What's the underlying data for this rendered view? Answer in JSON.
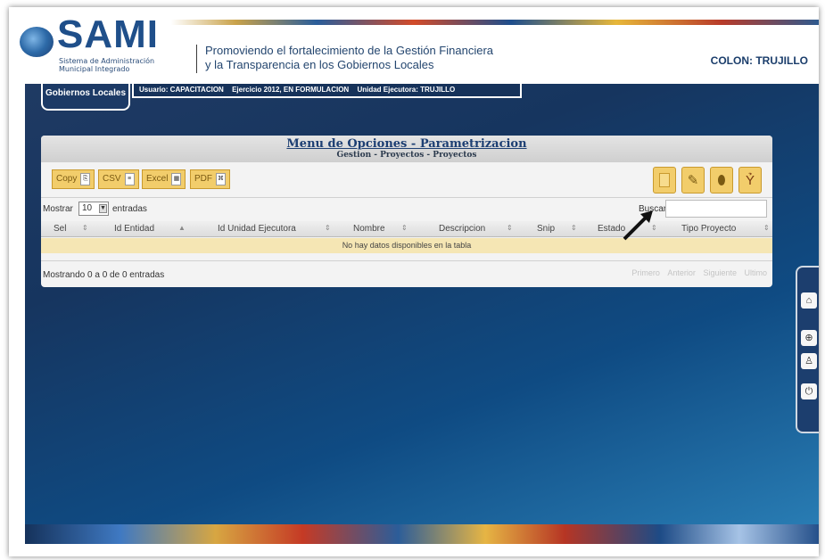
{
  "header": {
    "logo_title": "SAMI",
    "logo_subtitle_line1": "Sistema de Administración",
    "logo_subtitle_line2": "Municipal Integrado",
    "tagline_line1": "Promoviendo el fortalecimiento de la Gestión Financiera",
    "tagline_line2": "y la Transparencia en los Gobiernos Locales",
    "municipio": "COLON: TRUJILLO"
  },
  "nav": {
    "tab_label": "Gobiernos Locales",
    "user": "Usuario: CAPACITACION",
    "exercise": "Ejercicio 2012, EN FORMULACION",
    "unit": "Unidad Ejecutora: TRUJILLO"
  },
  "panel": {
    "title": "Menu de Opciones - Parametrizacion",
    "subtitle": "Gestion - Proyectos - Proyectos"
  },
  "export_buttons": [
    "Copy",
    "CSV",
    "Excel",
    "PDF"
  ],
  "action_buttons": [
    {
      "icon": "new-document-icon"
    },
    {
      "icon": "edit-pencil-icon"
    },
    {
      "icon": "eraser-icon"
    },
    {
      "icon": "broom-icon"
    }
  ],
  "table_controls": {
    "show_label": "Mostrar",
    "page_length": "10",
    "entries_label": "entradas",
    "search_label": "Buscar:",
    "search_value": ""
  },
  "table": {
    "columns": [
      "Sel",
      "Id Entidad",
      "Id Unidad Ejecutora",
      "Nombre",
      "Descripcion",
      "Snip",
      "Estado",
      "Tipo Proyecto"
    ],
    "empty_message": "No hay datos disponibles en la tabla"
  },
  "footer": {
    "info": "Mostrando 0 a 0 de 0 entradas",
    "pager": [
      "Primero",
      "Anterior",
      "Siguiente",
      "Ultimo"
    ]
  },
  "side_widget": {
    "buttons": [
      "home-icon",
      "link-icon",
      "user-icon",
      "power-icon"
    ]
  },
  "colors": {
    "brand_blue": "#1f4f8a",
    "button_gold": "#f2cd6b",
    "empty_row": "#f5e6b4"
  }
}
